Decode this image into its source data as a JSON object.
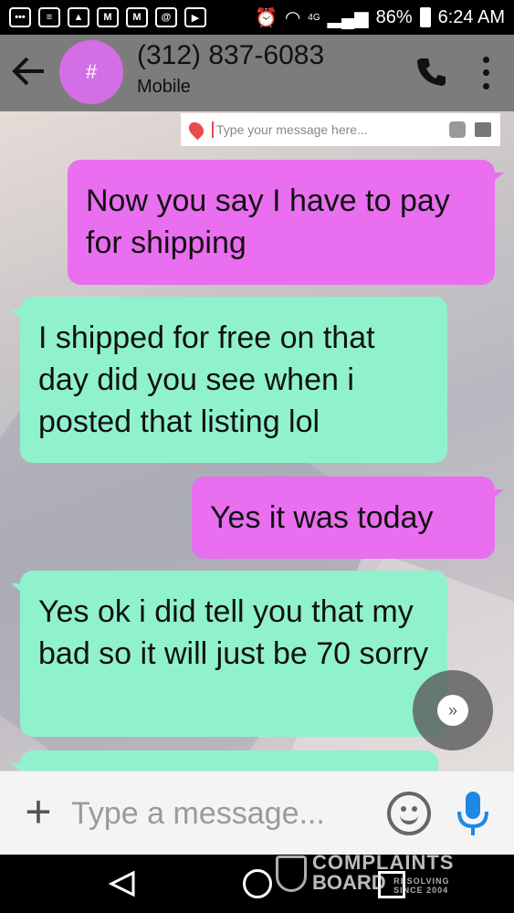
{
  "status_bar": {
    "battery": "86%",
    "time": "6:24 AM",
    "network": "4G"
  },
  "header": {
    "avatar_symbol": "#",
    "contact_number": "(312) 837-6083",
    "contact_label": "Mobile"
  },
  "embedded_compose": {
    "placeholder": "Type your message here..."
  },
  "messages": [
    {
      "direction": "outgoing",
      "text": "Now you say I have to pay for shipping"
    },
    {
      "direction": "incoming",
      "text": "I shipped for free on that day did you see when i posted that listing lol"
    },
    {
      "direction": "outgoing",
      "text": "Yes it was today"
    },
    {
      "direction": "incoming",
      "text": "Yes ok i did tell you that my bad so it will just be 70 sorry"
    }
  ],
  "compose": {
    "placeholder": "Type a message..."
  },
  "watermark": {
    "line1": "COMPLAINTS",
    "line2": "BOARD",
    "tag1": "RESOLVING",
    "tag2": "SINCE 2004"
  },
  "colors": {
    "outgoing_bubble": "#ea6ef0",
    "incoming_bubble": "#90f2cd",
    "header_bg": "#7c7c7c",
    "avatar_bg": "#d46ee6"
  }
}
